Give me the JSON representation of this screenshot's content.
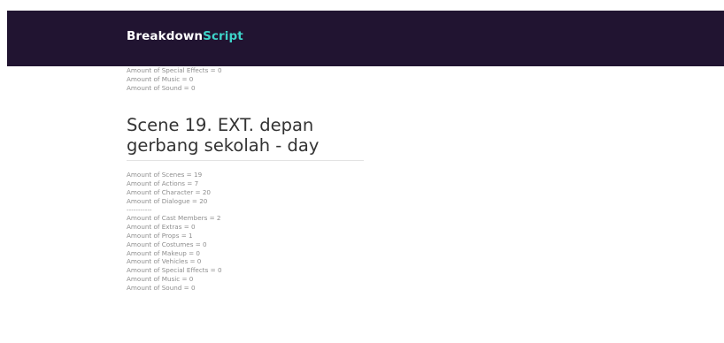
{
  "brand": {
    "part1": "Breakdown",
    "part2": "Script"
  },
  "top_stats": [
    "Amount of Special Effects = 0",
    "Amount of Music = 0",
    "Amount of Sound = 0"
  ],
  "scene": {
    "title": "Scene 19. EXT. depan gerbang sekolah - day",
    "stats": [
      "Amount of Scenes = 19",
      "Amount of Actions = 7",
      "Amount of Character = 20",
      "Amount of Dialogue = 20",
      "-----------",
      "Amount of Cast Members = 2",
      "Amount of Extras = 0",
      "Amount of Props = 1",
      "Amount of Costumes = 0",
      "Amount of Makeup = 0",
      "Amount of Vehicles = 0",
      "Amount of Special Effects = 0",
      "Amount of Music = 0",
      "Amount of Sound = 0"
    ]
  }
}
